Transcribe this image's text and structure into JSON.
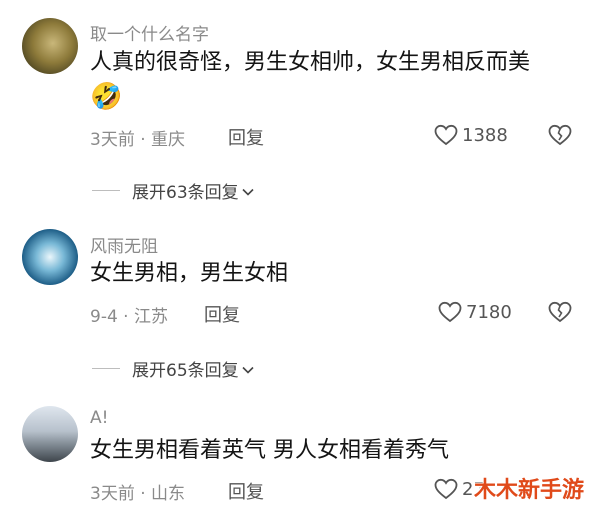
{
  "comments": [
    {
      "username": "取一个什么名字",
      "text": "人真的很奇怪，男生女相帅，女生男相反而美",
      "emoji": "🤣",
      "meta": "3天前 · 重庆",
      "reply_label": "回复",
      "likes": "1388"
    },
    {
      "username": "风雨无阻",
      "text": "女生男相，男生女相",
      "meta": "9-4 · 江苏",
      "reply_label": "回复",
      "likes": "7180"
    },
    {
      "username": "A!",
      "text": "女生男相看着英气 男人女相看着秀气",
      "meta": "3天前 · 山东",
      "reply_label": "回复",
      "likes": "27"
    }
  ],
  "expanders": [
    {
      "label": "展开63条回复"
    },
    {
      "label": "展开65条回复"
    }
  ],
  "watermark": "木木新手游",
  "colors": {
    "secondary_text": "#8a8a8a",
    "primary_text": "#141414",
    "watermark": "#e04a1a"
  },
  "icons": [
    "heart-outline-icon",
    "broken-heart-icon",
    "chevron-down-icon"
  ]
}
